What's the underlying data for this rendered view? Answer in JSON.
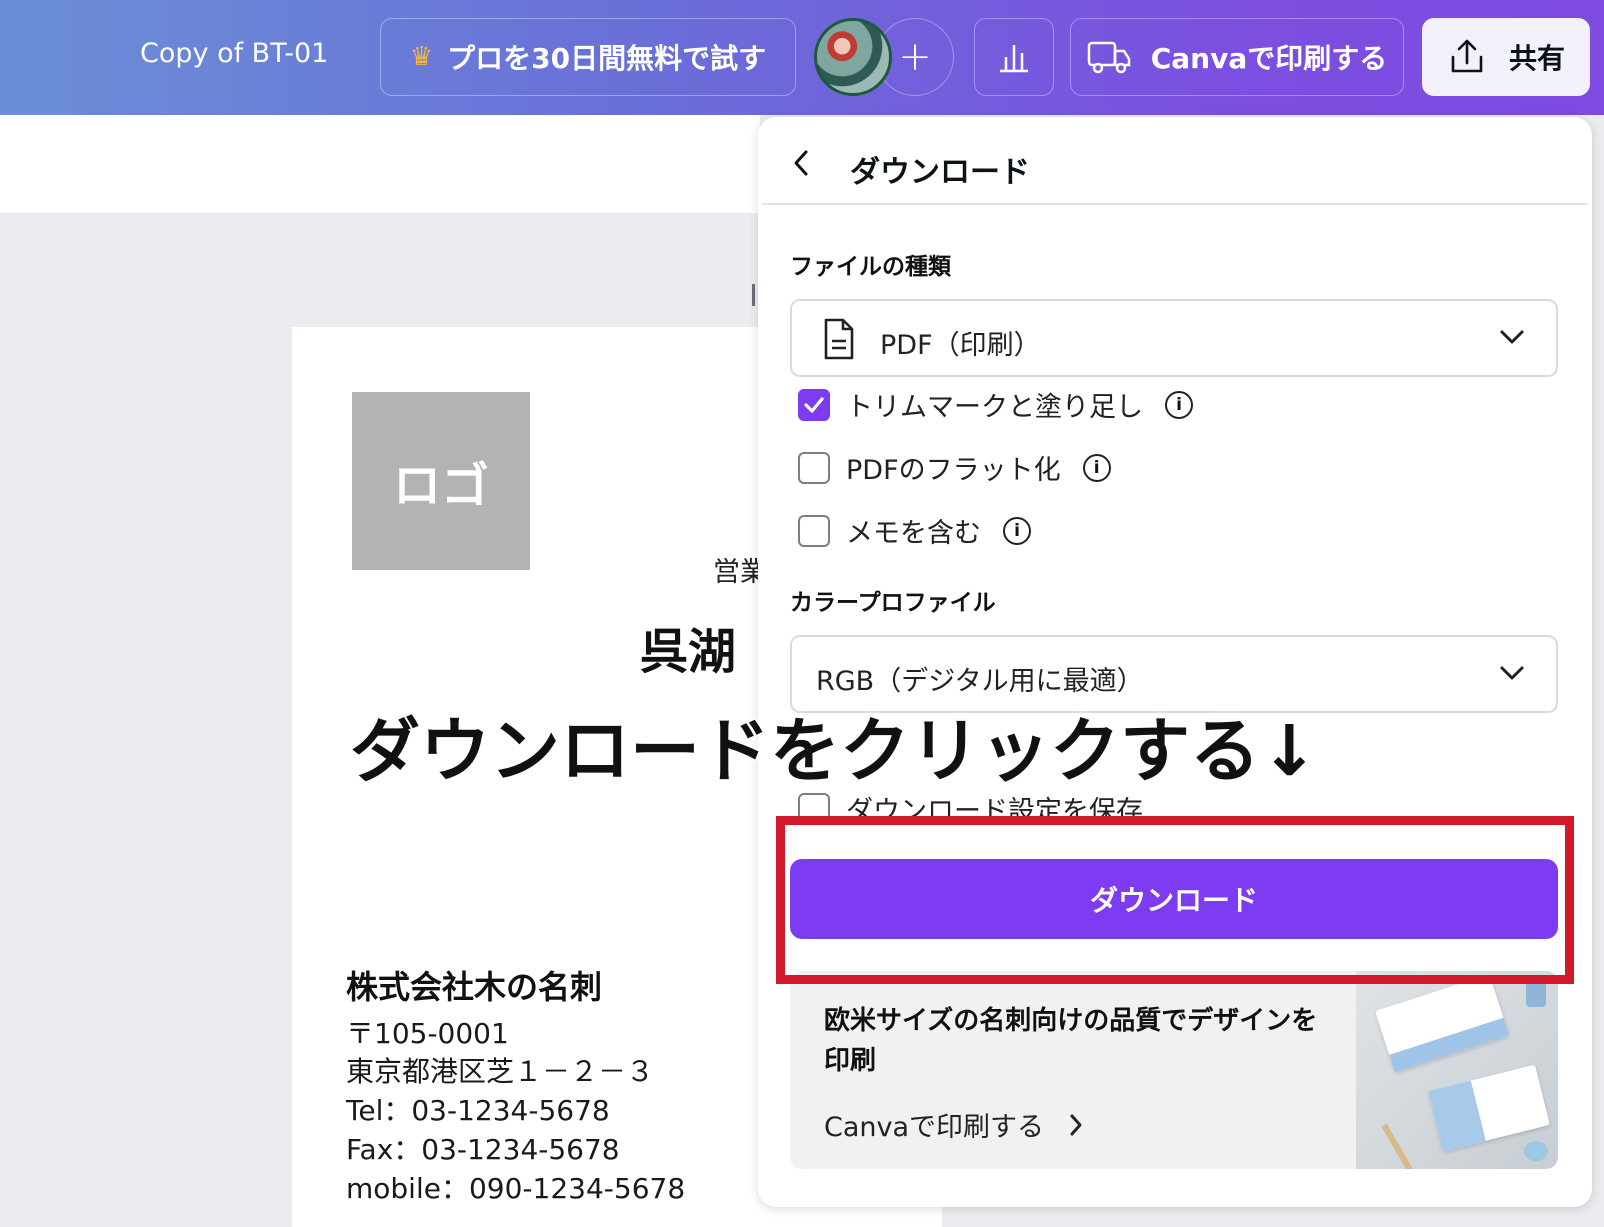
{
  "topbar": {
    "doc_title": "Copy of BT-01",
    "pro_trial_label": "プロを30日間無料で試す",
    "plus_label": "+",
    "print_label": "Canvaで印刷する",
    "share_label": "共有"
  },
  "card": {
    "logo_text": "ロゴ",
    "role_text": "営業",
    "person_name": "呉湖",
    "company_name": "株式会社木の名刺",
    "postal": "〒105-0001",
    "address": "東京都港区芝１－２－３",
    "tel": "Tel：03-1234-5678",
    "fax": "Fax：03-1234-5678",
    "mobile": "mobile：090-1234-5678"
  },
  "overlay_instruction": "ダウンロードをクリックする↓",
  "panel": {
    "back_icon": "chevron-left-icon",
    "title": "ダウンロード",
    "file_type_label": "ファイルの種類",
    "file_type_value": "PDF（印刷）",
    "options": [
      {
        "label": "トリムマークと塗り足し",
        "checked": true
      },
      {
        "label": "PDFのフラット化",
        "checked": false
      },
      {
        "label": "メモを含む",
        "checked": false
      }
    ],
    "color_profile_label": "カラープロファイル",
    "color_profile_value": "RGB（デジタル用に最適）",
    "save_settings_label": "ダウンロード設定を保存",
    "save_settings_checked": false,
    "download_button": "ダウンロード",
    "promo": {
      "title": "欧米サイズの名刺向けの品質でデザインを印刷",
      "link": "Canvaで印刷する"
    }
  },
  "colors": {
    "accent": "#7d3cf2",
    "highlight": "#d2192c",
    "topbar_start": "#6b8fd6",
    "topbar_end": "#7e4ae0"
  }
}
